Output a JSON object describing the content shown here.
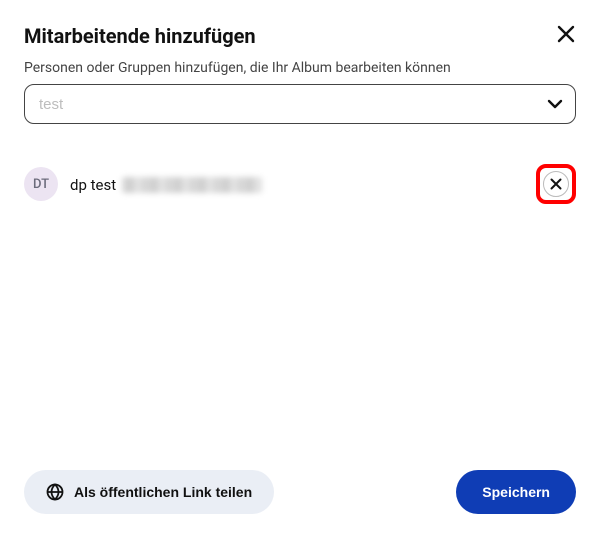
{
  "header": {
    "title": "Mitarbeitende hinzufügen"
  },
  "subtitle": "Personen oder Gruppen hinzufügen, die Ihr Album bearbeiten können",
  "search": {
    "placeholder": "test"
  },
  "collaborators": [
    {
      "initials": "DT",
      "name": "dp test"
    }
  ],
  "footer": {
    "share_label": "Als öffentlichen Link teilen",
    "save_label": "Speichern"
  }
}
